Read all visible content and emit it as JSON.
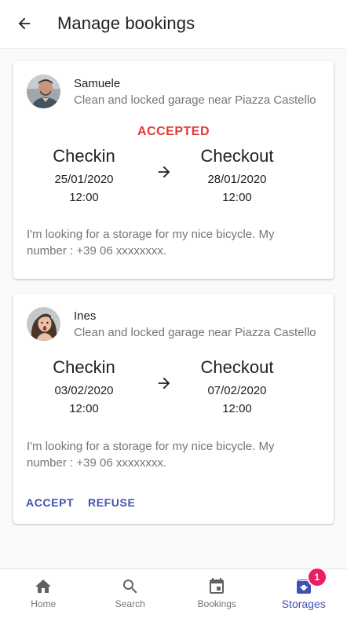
{
  "header": {
    "title": "Manage bookings"
  },
  "bookings": [
    {
      "user": "Samuele",
      "storage": "Clean and locked garage near Piazza Castello",
      "status": "ACCEPTED",
      "checkin_label": "Checkin",
      "checkin_date": "25/01/2020",
      "checkin_time": "12:00",
      "checkout_label": "Checkout",
      "checkout_date": "28/01/2020",
      "checkout_time": "12:00",
      "message": "I'm looking for a storage for my nice bicycle. My number : +39 06 xxxxxxxx."
    },
    {
      "user": "Ines",
      "storage": "Clean and locked garage near Piazza Castello",
      "checkin_label": "Checkin",
      "checkin_date": "03/02/2020",
      "checkin_time": "12:00",
      "checkout_label": "Checkout",
      "checkout_date": "07/02/2020",
      "checkout_time": "12:00",
      "message": "I'm looking for a storage for my nice bicycle. My number : +39 06 xxxxxxxx.",
      "actions": {
        "accept": "ACCEPT",
        "refuse": "REFUSE"
      }
    }
  ],
  "bottom_nav": {
    "items": [
      {
        "label": "Home",
        "icon": "home-icon"
      },
      {
        "label": "Search",
        "icon": "search-icon"
      },
      {
        "label": "Bookings",
        "icon": "calendar-icon"
      },
      {
        "label": "Storages",
        "icon": "storage-box-icon",
        "active": true,
        "badge": "1"
      }
    ]
  },
  "colors": {
    "accent": "#3f51b5",
    "status_accepted": "#e53935",
    "badge": "#e91e63"
  }
}
